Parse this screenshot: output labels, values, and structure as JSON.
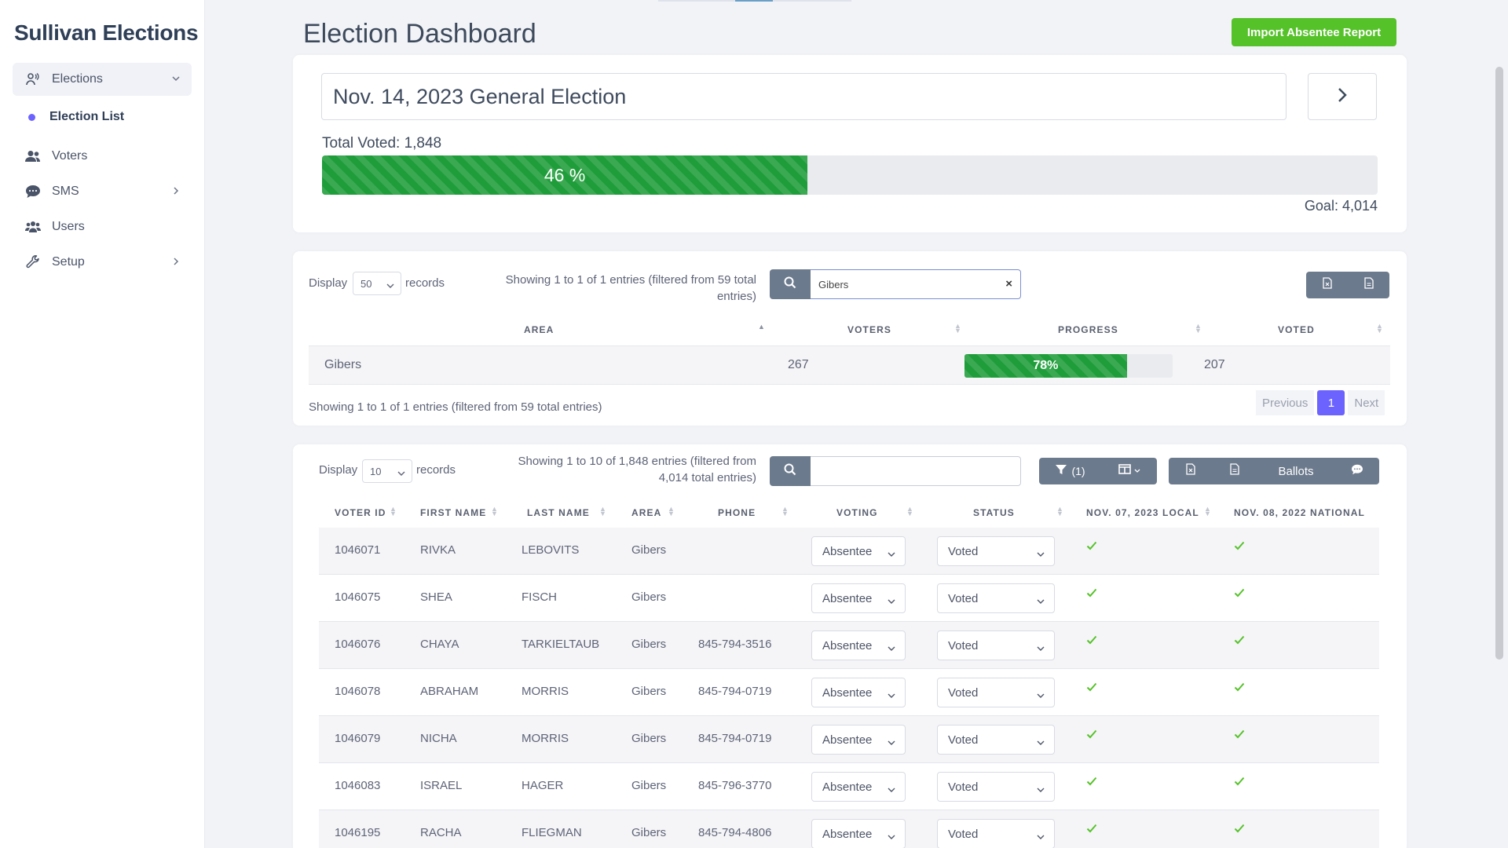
{
  "brand": "Sullivan Elections",
  "sidebar": {
    "elections": "Elections",
    "election_list": "Election List",
    "voters": "Voters",
    "sms": "SMS",
    "users": "Users",
    "setup": "Setup"
  },
  "header": {
    "title": "Election Dashboard",
    "import_button": "Import Absentee Report"
  },
  "summary": {
    "election": "Nov. 14, 2023 General Election",
    "total_voted": "Total Voted: 1,848",
    "progress_label": "46 %",
    "progress_percent": 46,
    "goal": "Goal: 4,014"
  },
  "area_table": {
    "display_label": "Display",
    "display_value": "50",
    "records_label": "records",
    "info_line1": "Showing 1 to 1 of 1 entries (filtered from 59 total",
    "info_line2": "entries)",
    "search_value": "Gibers",
    "headers": [
      "AREA",
      "VOTERS",
      "PROGRESS",
      "VOTED"
    ],
    "row": {
      "area": "Gibers",
      "voters": "267",
      "progress_label": "78%",
      "progress_percent": 78,
      "voted": "207"
    },
    "footer_info": "Showing 1 to 1 of 1 entries (filtered from 59 total entries)",
    "pager": {
      "prev": "Previous",
      "page": "1",
      "next": "Next"
    }
  },
  "voter_table": {
    "display_label": "Display",
    "display_value": "10",
    "records_label": "records",
    "info_line1": "Showing 1 to 10 of 1,848 entries (filtered from",
    "info_line2": "4,014 total entries)",
    "search_value": "",
    "filter_label": "(1)",
    "ballots_label": "Ballots",
    "headers": [
      "VOTER ID",
      "FIRST NAME",
      "LAST NAME",
      "AREA",
      "PHONE",
      "VOTING",
      "STATUS",
      "NOV. 07, 2023 LOCAL",
      "NOV. 08, 2022 NATIONAL"
    ],
    "rows": [
      {
        "id": "1046071",
        "first": "RIVKA",
        "last": "LEBOVITS",
        "area": "Gibers",
        "phone": "",
        "voting": "Absentee",
        "status": "Voted"
      },
      {
        "id": "1046075",
        "first": "SHEA",
        "last": "FISCH",
        "area": "Gibers",
        "phone": "",
        "voting": "Absentee",
        "status": "Voted"
      },
      {
        "id": "1046076",
        "first": "CHAYA",
        "last": "TARKIELTAUB",
        "area": "Gibers",
        "phone": "845-794-3516",
        "voting": "Absentee",
        "status": "Voted"
      },
      {
        "id": "1046078",
        "first": "ABRAHAM",
        "last": "MORRIS",
        "area": "Gibers",
        "phone": "845-794-0719",
        "voting": "Absentee",
        "status": "Voted"
      },
      {
        "id": "1046079",
        "first": "NICHA",
        "last": "MORRIS",
        "area": "Gibers",
        "phone": "845-794-0719",
        "voting": "Absentee",
        "status": "Voted"
      },
      {
        "id": "1046083",
        "first": "ISRAEL",
        "last": "HAGER",
        "area": "Gibers",
        "phone": "845-796-3770",
        "voting": "Absentee",
        "status": "Voted"
      },
      {
        "id": "1046195",
        "first": "RACHA",
        "last": "FLIEGMAN",
        "area": "Gibers",
        "phone": "845-794-4806",
        "voting": "Absentee",
        "status": "Voted"
      }
    ]
  },
  "colors": {
    "accent": "#6c63ff",
    "success": "#56c22a",
    "progress": "#1f9d3a",
    "button_gray": "#6c7a8d"
  }
}
